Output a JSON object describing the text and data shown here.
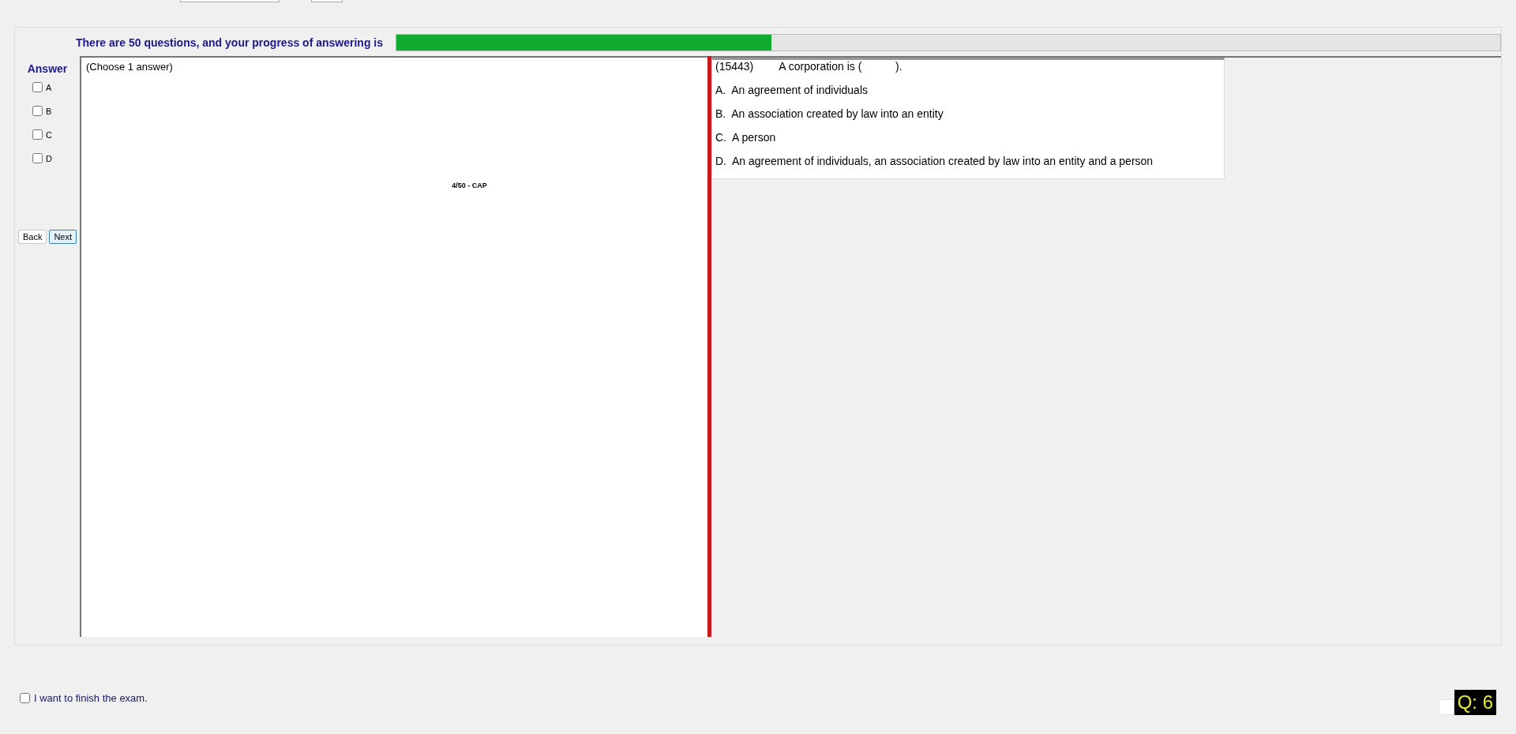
{
  "progress": {
    "label": "There are 50 questions, and your progress of answering is",
    "level": 0.34
  },
  "answer_panel": {
    "title": "Answer",
    "options": [
      {
        "label": "A",
        "checked": false
      },
      {
        "label": "B",
        "checked": false
      },
      {
        "label": "C",
        "checked": false
      },
      {
        "label": "D",
        "checked": false
      }
    ],
    "buttons": [
      {
        "label": "Back",
        "selected": false
      },
      {
        "label": "Next",
        "selected": true
      }
    ]
  },
  "instruction": "(Choose 1 answer)",
  "page_label": "4/50 - CAP",
  "question": {
    "number": "(15443)",
    "text": "A corporation is (           ).",
    "choices": [
      "A.  An agreement of individuals",
      "B.  An association created by law into an entity",
      "C.  A person",
      "D.  An agreement of individuals, an association created by law into an entity and a person"
    ]
  },
  "finish": {
    "label": "I want to finish the exam.",
    "checked": false
  },
  "question_counter": "Q: 6"
}
